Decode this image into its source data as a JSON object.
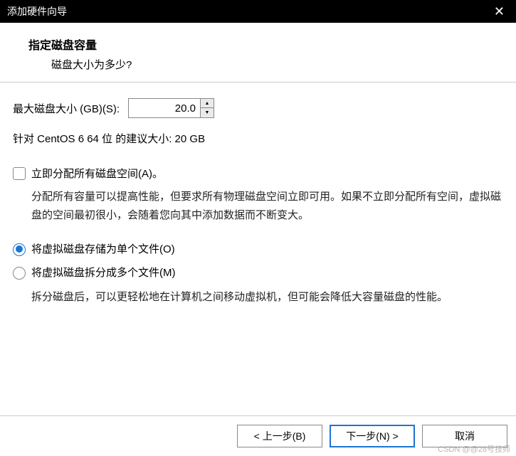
{
  "titlebar": {
    "title": "添加硬件向导"
  },
  "header": {
    "title": "指定磁盘容量",
    "subtitle": "磁盘大小为多少?"
  },
  "size": {
    "label": "最大磁盘大小 (GB)(S):",
    "value": "20.0"
  },
  "recommend": {
    "text": "针对 CentOS 6 64 位 的建议大小: 20 GB"
  },
  "allocate": {
    "label": "立即分配所有磁盘空间(A)。",
    "desc": "分配所有容量可以提高性能，但要求所有物理磁盘空间立即可用。如果不立即分配所有空间，虚拟磁盘的空间最初很小，会随着您向其中添加数据而不断变大。"
  },
  "radios": {
    "single": "将虚拟磁盘存储为单个文件(O)",
    "multi": "将虚拟磁盘拆分成多个文件(M)",
    "multi_desc": "拆分磁盘后，可以更轻松地在计算机之间移动虚拟机，但可能会降低大容量磁盘的性能。"
  },
  "footer": {
    "back": "< 上一步(B)",
    "next": "下一步(N) >",
    "cancel": "取消"
  },
  "watermark": "CSDN @@28号技师"
}
